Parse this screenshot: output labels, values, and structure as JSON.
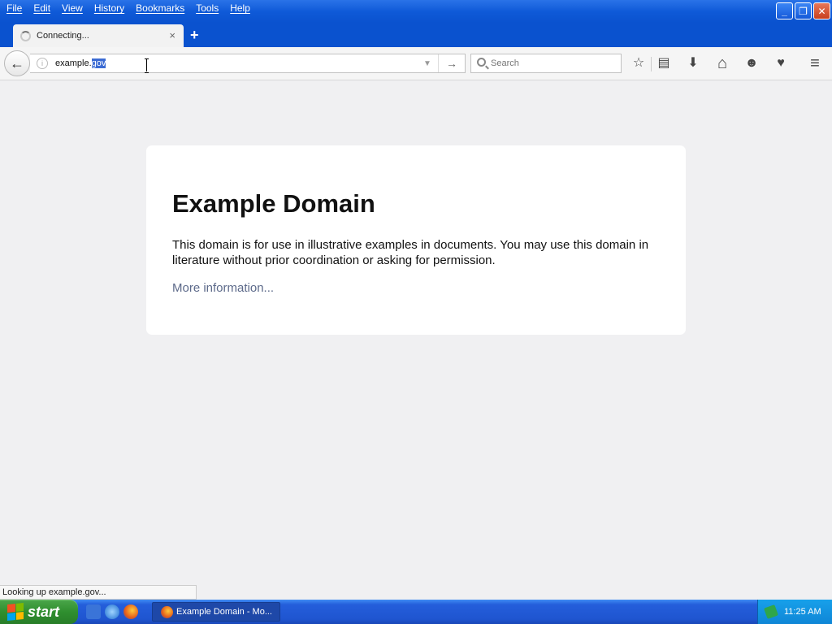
{
  "menubar": {
    "items": [
      {
        "label": "File"
      },
      {
        "label": "Edit"
      },
      {
        "label": "View"
      },
      {
        "label": "History"
      },
      {
        "label": "Bookmarks"
      },
      {
        "label": "Tools"
      },
      {
        "label": "Help"
      }
    ]
  },
  "window_controls": {
    "minimize": "_",
    "restore": "❐",
    "close": "✕"
  },
  "tab": {
    "title": "Connecting...",
    "close": "×",
    "new_tab": "+"
  },
  "navbar": {
    "back": "←",
    "url_main": "example.",
    "url_selected": "gov",
    "url_go": "→",
    "url_dropdown": "▼",
    "info": "i"
  },
  "search": {
    "placeholder": "Search"
  },
  "toolbar_icons": {
    "bookmark_star": "☆",
    "reading_list": "▤",
    "downloads": "⬇",
    "home": "⌂",
    "hello": "☻",
    "pocket": "♥",
    "menu": "≡"
  },
  "page": {
    "title": "Example Domain",
    "description": "This domain is for use in illustrative examples in documents. You may use this domain in literature without prior coordination or asking for permission.",
    "link": "More information..."
  },
  "status": {
    "text": "Looking up example.gov..."
  },
  "taskbar": {
    "start_label": "start",
    "task_item": "Example Domain - Mo...",
    "clock": "11:25 AM"
  }
}
